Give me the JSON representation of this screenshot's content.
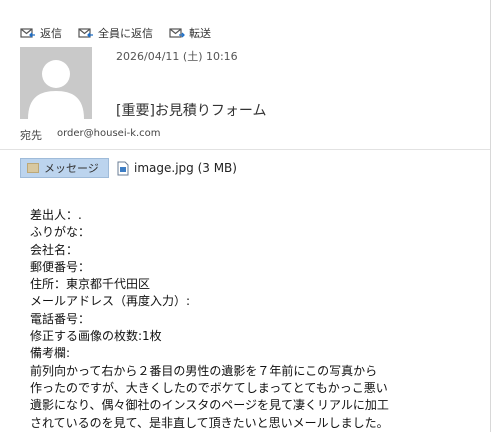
{
  "toolbar": {
    "reply": "返信",
    "reply_all": "全員に返信",
    "forward": "転送"
  },
  "header": {
    "date": "2026/04/11 (土) 10:16",
    "subject": "[重要]お見積りフォーム",
    "to_label": "宛先",
    "to_address": "order@housei-k.com"
  },
  "tabs": {
    "message": "メッセージ",
    "attachment": "image.jpg (3 MB)"
  },
  "body_lines": [
    "差出人：.",
    "ふりがな：",
    "会社名：",
    "郵便番号：",
    "住所：東京都千代田区",
    "メールアドレス（再度入力）:",
    "電話番号：",
    "修正する画像の枚数:1枚",
    "備考欄:",
    "前列向かって右から２番目の男性の遺影を７年前にこの写真から",
    "作ったのですが、大きくしたのでボケてしまってとてもかっこ悪い",
    "遺影になり、偶々御社のインスタのページを見て凄くリアルに加工",
    "されているのを見て、是非直して頂きたいと思いメールしました。"
  ],
  "colors": {
    "tab_active": "#bcd4ee",
    "avatar_bg": "#c9c9c9"
  }
}
